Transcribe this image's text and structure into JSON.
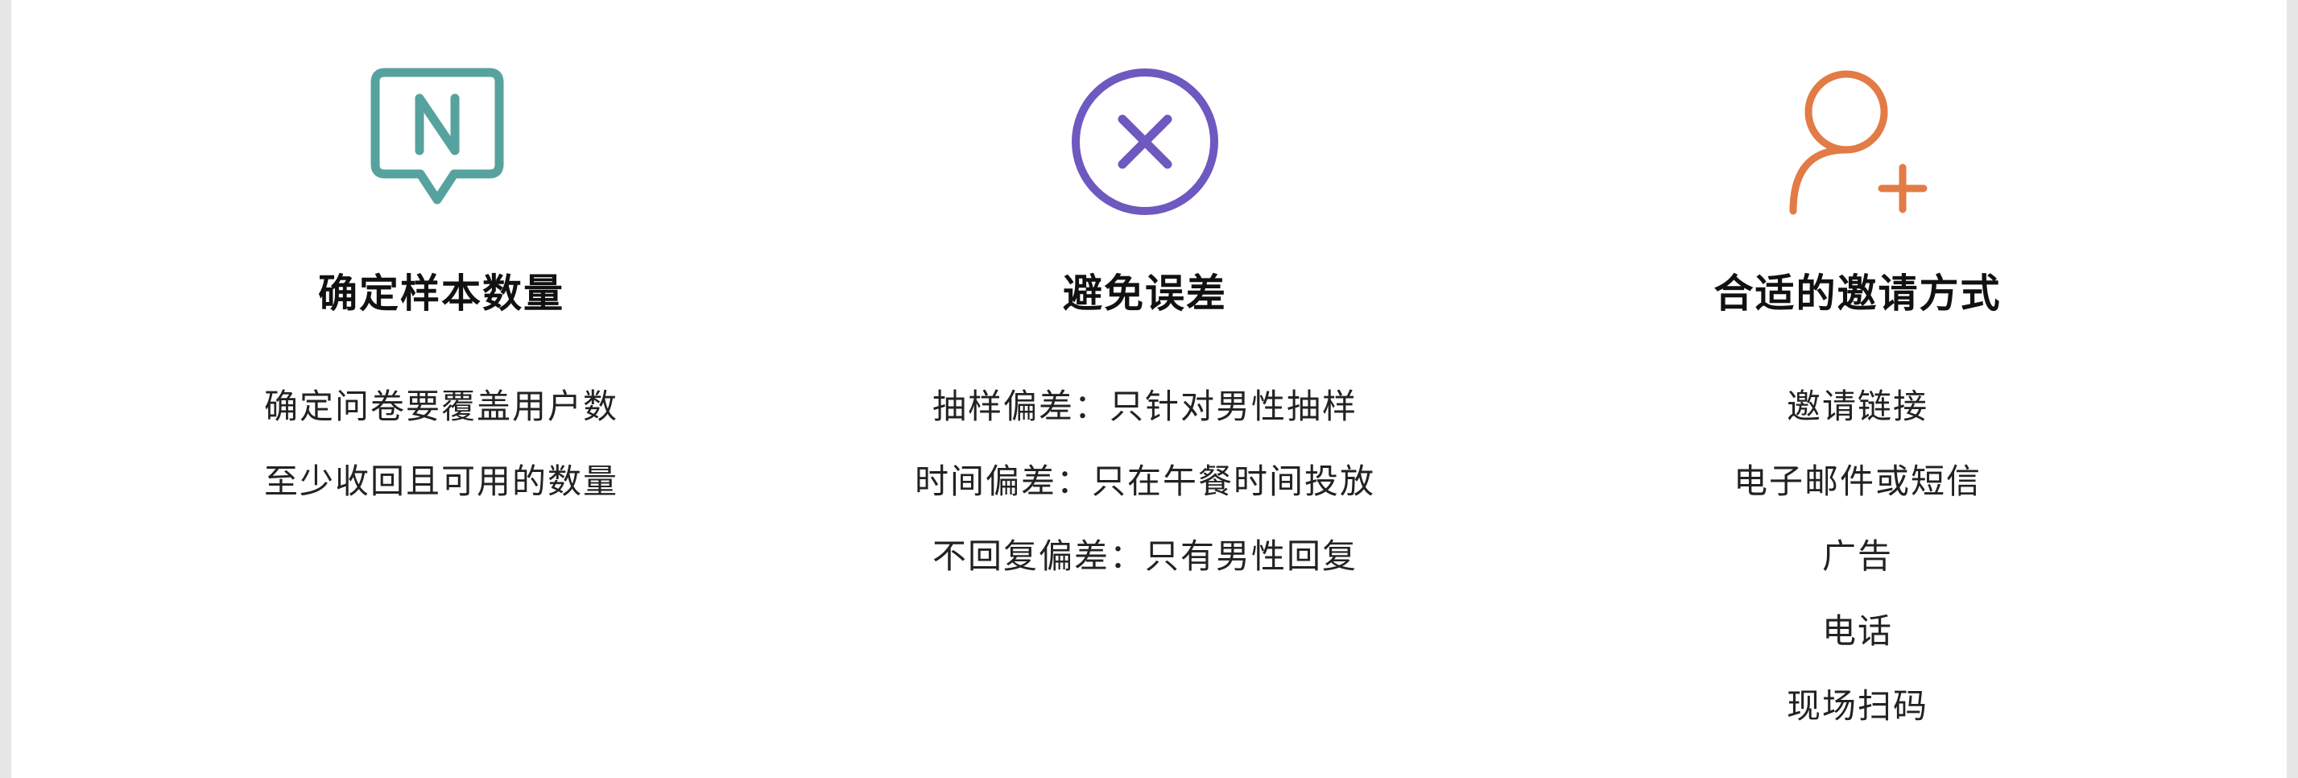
{
  "colors": {
    "teal": "#56a29e",
    "purple": "#6d59c0",
    "orange": "#e27b45"
  },
  "columns": [
    {
      "icon": "message-n-icon",
      "title": "确定样本数量",
      "items": [
        "确定问卷要覆盖用户数",
        "至少收回且可用的数量"
      ]
    },
    {
      "icon": "circle-x-icon",
      "title": "避免误差",
      "items": [
        "抽样偏差：只针对男性抽样",
        "时间偏差：只在午餐时间投放",
        "不回复偏差：只有男性回复"
      ]
    },
    {
      "icon": "add-user-icon",
      "title": "合适的邀请方式",
      "items": [
        "邀请链接",
        "电子邮件或短信",
        "广告",
        "电话",
        "现场扫码"
      ]
    }
  ]
}
